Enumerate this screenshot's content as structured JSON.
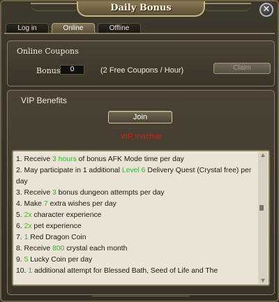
{
  "window": {
    "title": "Daily Bonus",
    "close_icon": "x-close-icon"
  },
  "tabs": [
    {
      "label": "Log in",
      "active": false
    },
    {
      "label": "Online",
      "active": true
    },
    {
      "label": "Offline",
      "active": false
    }
  ],
  "coupons": {
    "heading": "Online Coupons",
    "bonus_label": "Bonus",
    "bonus_value": "0",
    "note": "(2 Free Coupons / Hour)",
    "claim_label": "Claim"
  },
  "vip": {
    "heading": "VIP Benefits",
    "join_label": "Join",
    "status_text": "VIP Inactive",
    "benefits": [
      {
        "pre": "1. Receive ",
        "hl": "3 hours",
        "post": " of bonus AFK Mode time per day"
      },
      {
        "pre": "2. May participate in 1 additional ",
        "hl": "Level 6",
        "post": " Delivery Quest (Crystal free) per day"
      },
      {
        "pre": "3. Receive ",
        "hl": "3",
        "post": " bonus dungeon attempts per day"
      },
      {
        "pre": "4. Make ",
        "hl": "7",
        "post": " extra wishes per day"
      },
      {
        "pre": "5. ",
        "hl": "2x",
        "post": " character experience"
      },
      {
        "pre": "6. ",
        "hl": "2x",
        "post": " pet experience"
      },
      {
        "pre": "7. ",
        "hl": "1",
        "post": " Red Dragon Coin"
      },
      {
        "pre": "8. Receive ",
        "hl": "800",
        "post": " crystal each month"
      },
      {
        "pre": "9. ",
        "hl": "5",
        "post": " Lucky Coin per day"
      },
      {
        "pre": "10. ",
        "hl": "1",
        "post": " additional attempt for Blessed Bath, Seed of Life and The"
      }
    ]
  },
  "colors": {
    "highlight": "#2bbd25",
    "inactive_status": "#e01b10",
    "frame": "#8b7d5c"
  }
}
